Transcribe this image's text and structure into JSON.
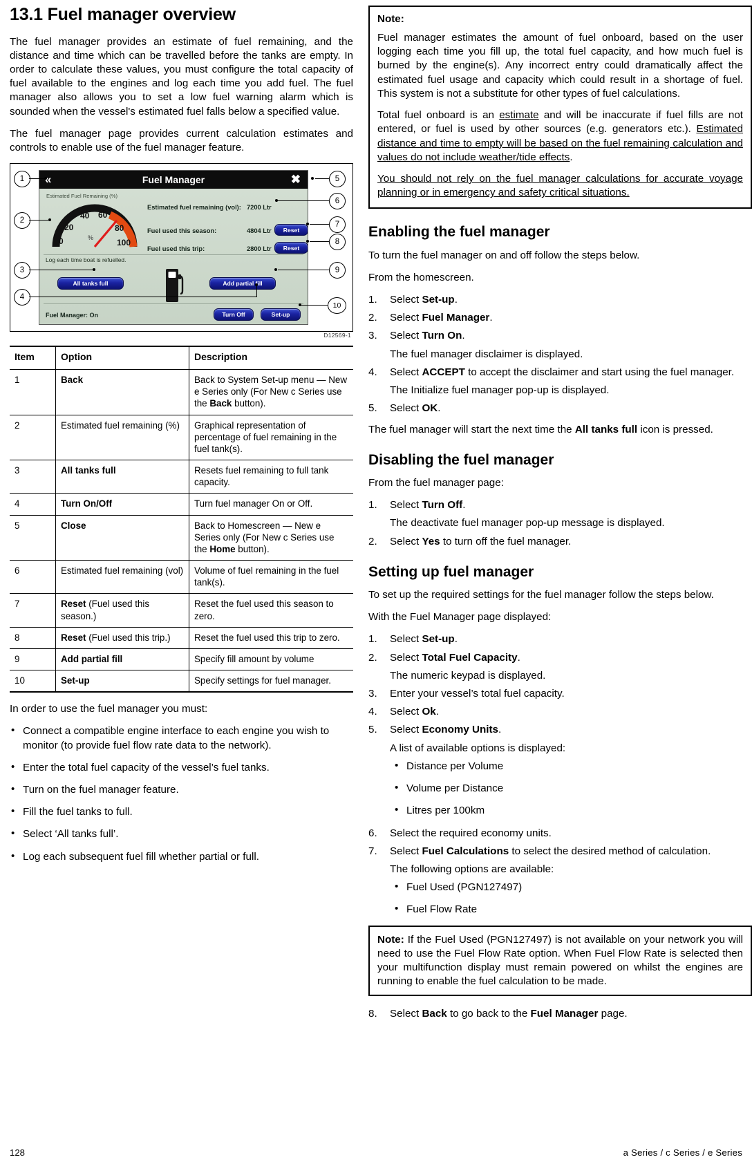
{
  "left": {
    "heading": "13.1 Fuel manager overview",
    "para1": "The fuel manager provides an estimate of fuel remaining, and the distance and time which can be travelled before the tanks are empty. In order to calculate these values, you must configure the total capacity of fuel available to the engines and log each time you add fuel. The fuel manager also allows you to set a low fuel warning alarm which is sounded when the vessel's estimated fuel falls below a specified value.",
    "para2": "The fuel manager page provides current calculation estimates and controls to enable use of the fuel manager feature.",
    "intro_list": "In order to use the fuel manager you must:",
    "bullets": [
      "Connect a compatible engine interface to each engine you wish to monitor (to provide fuel flow rate data to the network).",
      "Enter the total fuel capacity of the vessel’s fuel tanks.",
      "Turn on the fuel manager feature.",
      "Fill the fuel tanks to full.",
      "Select ‘All tanks full’.",
      "Log each subsequent fuel fill whether partial or full."
    ]
  },
  "figure": {
    "caption_id": "D12569-1",
    "device": {
      "title": "Fuel Manager",
      "back_icon": "back-chevrons-icon",
      "close_icon": "close-x-icon",
      "gauge_title": "Estimated Fuel Remaining (%)",
      "gauge_ticks": [
        "0",
        "20",
        "40",
        "60",
        "80",
        "100"
      ],
      "gauge_unit": "%",
      "rows": [
        {
          "label": "Estimated fuel remaining (vol):",
          "value": "7200 Ltr",
          "button": ""
        },
        {
          "label": "Fuel used this season:",
          "value": "4804 Ltr",
          "button": "Reset"
        },
        {
          "label": "Fuel used this trip:",
          "value": "2800 Ltr",
          "button": "Reset"
        }
      ],
      "log_hint": "Log each time boat is refuelled.",
      "all_tanks_full": "All tanks full",
      "add_partial_fill": "Add partial fill",
      "status": "Fuel Manager: On",
      "turn_off": "Turn Off",
      "setup": "Set-up"
    },
    "callouts": [
      "1",
      "2",
      "3",
      "4",
      "5",
      "6",
      "7",
      "8",
      "9",
      "10"
    ]
  },
  "table": {
    "headers": [
      "Item",
      "Option",
      "Description"
    ],
    "rows": [
      {
        "item": "1",
        "option_bold": "Back",
        "option_rest": "",
        "desc_parts": [
          {
            "t": "Back to System Set-up menu — New e Series only (For New c Series use the ",
            "b": false
          },
          {
            "t": "Back",
            "b": true
          },
          {
            "t": " button).",
            "b": false
          }
        ],
        "option_is_bold": true
      },
      {
        "item": "2",
        "option_bold": "",
        "option_rest": "Estimated fuel remaining (%)",
        "desc_parts": [
          {
            "t": "Graphical representation of percentage of fuel remaining in the fuel tank(s).",
            "b": false
          }
        ],
        "option_is_bold": false
      },
      {
        "item": "3",
        "option_bold": "All tanks full",
        "option_rest": "",
        "desc_parts": [
          {
            "t": "Resets fuel remaining to full tank capacity.",
            "b": false
          }
        ],
        "option_is_bold": true
      },
      {
        "item": "4",
        "option_bold": "Turn On/Off",
        "option_rest": "",
        "desc_parts": [
          {
            "t": "Turn fuel manager On or Off.",
            "b": false
          }
        ],
        "option_is_bold": true
      },
      {
        "item": "5",
        "option_bold": "Close",
        "option_rest": "",
        "desc_parts": [
          {
            "t": "Back to Homescreen — New e Series only (For New c Series use the ",
            "b": false
          },
          {
            "t": "Home",
            "b": true
          },
          {
            "t": " button).",
            "b": false
          }
        ],
        "option_is_bold": true
      },
      {
        "item": "6",
        "option_bold": "",
        "option_rest": "Estimated fuel remaining (vol)",
        "desc_parts": [
          {
            "t": "Volume of fuel remaining in the fuel tank(s).",
            "b": false
          }
        ],
        "option_is_bold": false
      },
      {
        "item": "7",
        "option_bold": "Reset",
        "option_rest": " (Fuel used this season.)",
        "desc_parts": [
          {
            "t": "Reset the fuel used this season to zero.",
            "b": false
          }
        ],
        "option_is_bold": true
      },
      {
        "item": "8",
        "option_bold": "Reset",
        "option_rest": " (Fuel used this trip.)",
        "desc_parts": [
          {
            "t": "Reset the fuel used this trip to zero.",
            "b": false
          }
        ],
        "option_is_bold": true
      },
      {
        "item": "9",
        "option_bold": "Add partial fill",
        "option_rest": "",
        "desc_parts": [
          {
            "t": "Specify fill amount by volume",
            "b": false
          }
        ],
        "option_is_bold": true
      },
      {
        "item": "10",
        "option_bold": "Set-up",
        "option_rest": "",
        "desc_parts": [
          {
            "t": "Specify settings for fuel manager.",
            "b": false
          }
        ],
        "option_is_bold": true
      }
    ]
  },
  "note_top": {
    "title": "Note:",
    "p1": "Fuel manager estimates the amount of fuel onboard, based on the user logging each time you fill up, the total fuel capacity, and how much fuel is burned by the engine(s). Any incorrect entry could dramatically affect the estimated fuel usage and capacity which could result in a shortage of fuel. This system is not a substitute for other types of fuel calculations.",
    "p2_a": "Total fuel onboard is an ",
    "p2_u1": "estimate",
    "p2_b": " and will be inaccurate if fuel fills are not entered, or fuel is used by other sources (e.g. generators etc.).  ",
    "p2_u2": "Estimated distance and time to empty will be based on the fuel remaining calculation and values do not include weather/tide effects",
    "p2_c": ".",
    "p3_u": "You should not rely on the fuel manager calculations for accurate voyage planning or in emergency and safety critical situations."
  },
  "enabling": {
    "heading": "Enabling the fuel manager",
    "intro1": "To turn the fuel manager on and off follow the steps below.",
    "intro2": "From the homescreen.",
    "steps": [
      {
        "num": "1.",
        "pre": "Select ",
        "bold": "Set-up",
        "post": "."
      },
      {
        "num": "2.",
        "pre": "Select ",
        "bold": "Fuel Manager",
        "post": "."
      },
      {
        "num": "3.",
        "pre": "Select ",
        "bold": "Turn On",
        "post": ".",
        "sub": "The fuel manager disclaimer is displayed."
      },
      {
        "num": "4.",
        "pre": "Select ",
        "bold": "ACCEPT",
        "post": " to accept the disclaimer and start using the fuel manager.",
        "sub": "The Initialize fuel manager pop-up is displayed."
      },
      {
        "num": "5.",
        "pre": "Select ",
        "bold": "OK",
        "post": "."
      }
    ],
    "outro_a": "The fuel manager will start the next time the ",
    "outro_b": "All tanks full",
    "outro_c": " icon is pressed."
  },
  "disabling": {
    "heading": "Disabling the fuel manager",
    "intro": "From the fuel manager page:",
    "steps": [
      {
        "num": "1.",
        "pre": "Select ",
        "bold": "Turn Off",
        "post": ".",
        "sub": "The deactivate fuel manager pop-up message is displayed."
      },
      {
        "num": "2.",
        "pre": "Select ",
        "bold": "Yes",
        "post": " to turn off the fuel manager."
      }
    ]
  },
  "setting_up": {
    "heading": "Setting up fuel manager",
    "intro1": "To set up the required settings for the fuel manager follow the steps below.",
    "intro2": "With the Fuel Manager page displayed:",
    "steps": [
      {
        "num": "1.",
        "pre": "Select ",
        "bold": "Set-up",
        "post": "."
      },
      {
        "num": "2.",
        "pre": "Select ",
        "bold": "Total Fuel Capacity",
        "post": ".",
        "sub": "The numeric keypad is displayed."
      },
      {
        "num": "3.",
        "pre": "Enter your vessel’s total fuel capacity.",
        "bold": "",
        "post": ""
      },
      {
        "num": "4.",
        "pre": "Select ",
        "bold": "Ok",
        "post": "."
      },
      {
        "num": "5.",
        "pre": "Select ",
        "bold": "Economy Units",
        "post": ".",
        "sub": "A list of available options is displayed:"
      },
      {
        "num": "6.",
        "pre": "Select the required economy units.",
        "bold": "",
        "post": ""
      },
      {
        "num": "7.",
        "pre": "Select ",
        "bold": "Fuel Calculations",
        "post": " to select the desired method of calculation.",
        "sub": "The following options are available:"
      }
    ],
    "economy_options": [
      "Distance per Volume",
      "Volume per Distance",
      "Litres per 100km"
    ],
    "fuel_calc_options": [
      "Fuel Used (PGN127497)",
      "Fuel Flow Rate"
    ],
    "step8": {
      "num": "8.",
      "pre": "Select ",
      "bold": "Back",
      "mid": " to go back to the ",
      "bold2": "Fuel Manager",
      "post": " page."
    }
  },
  "note_bottom": {
    "title": "Note:",
    "text": " If the Fuel Used (PGN127497) is not available on your network you will need to use the Fuel Flow Rate option. When Fuel Flow Rate is selected then your multifunction display must remain powered on whilst the engines are running to enable the fuel calculation to be made."
  },
  "footer": {
    "page_number": "128",
    "series": "a Series / c Series / e Series"
  }
}
